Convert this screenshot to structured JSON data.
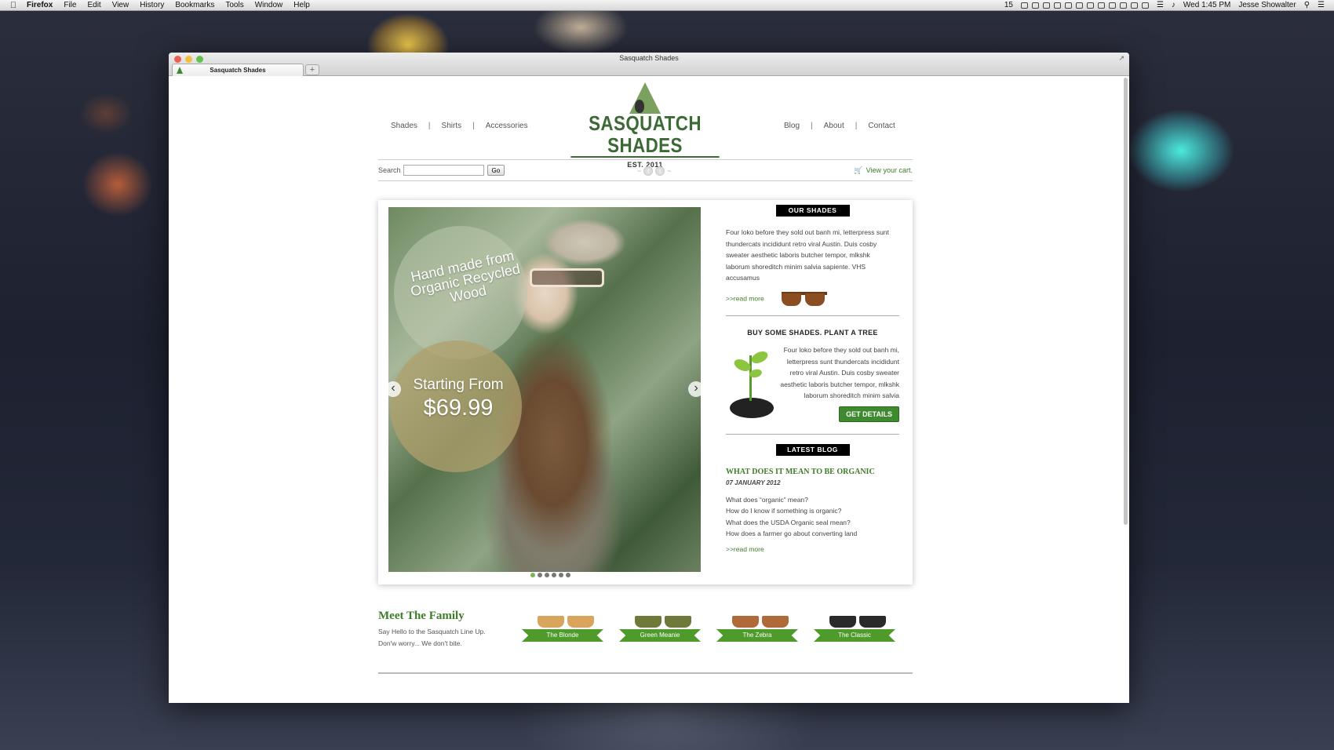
{
  "menubar": {
    "app_name": "Firefox",
    "items": [
      "File",
      "Edit",
      "View",
      "History",
      "Bookmarks",
      "Tools",
      "Window",
      "Help"
    ],
    "clock": "Wed 1:45 PM",
    "user": "Jesse Showalter",
    "badge": "15"
  },
  "window": {
    "title": "Sasquatch Shades",
    "tab_label": "Sasquatch Shades",
    "new_tab": "+"
  },
  "nav": {
    "left": [
      "Shades",
      "Shirts",
      "Accessories"
    ],
    "right": [
      "Blog",
      "About",
      "Contact"
    ],
    "separator": "|"
  },
  "logo": {
    "name": "SASQUATCH SHADES",
    "est": "EST. 2011"
  },
  "search": {
    "label": "Search",
    "value": "",
    "button": "Go"
  },
  "cart": {
    "label": "View your cart."
  },
  "hero": {
    "line1": "Hand made from Organic Recycled Wood",
    "starting": "Starting From",
    "price": "$69.99",
    "prev": "‹",
    "next": "›",
    "slide_count": 6,
    "active_slide": 1
  },
  "our_shades": {
    "label": "OUR SHADES",
    "text": "Four loko before they sold out banh mi, letterpress sunt thundercats incididunt retro viral Austin. Duis cosby sweater aesthetic laboris butcher tempor, mlkshk laborum shoreditch minim salvia sapiente. VHS accusamus",
    "read_more": ">>read more"
  },
  "plant_tree": {
    "title": "BUY SOME SHADES. PLANT A TREE",
    "text": "Four loko before they sold out banh mi, letterpress sunt thundercats incididunt retro viral Austin. Duis cosby sweater aesthetic laboris butcher tempor, mlkshk laborum shoreditch minim salvia",
    "button": "GET DETAILS"
  },
  "latest_blog": {
    "label": "LATEST BLOG",
    "title": "WHAT DOES IT MEAN TO BE ORGANIC",
    "date": "07 JANUARY 2012",
    "lines": [
      "What does “organic” mean?",
      "How do I know if something is organic?",
      "What does the USDA Organic seal mean?",
      "How does a farmer go about converting land"
    ],
    "read_more": ">>read more"
  },
  "family": {
    "title": "Meet The Family",
    "desc1": "Say Hello to the Sasquatch Line Up.",
    "desc2": "Don'w worry... We don't bite.",
    "products": [
      {
        "name": "The Blonde",
        "color": "#d9a55c"
      },
      {
        "name": "Green Meanie",
        "color": "#6f7a3a"
      },
      {
        "name": "The Zebra",
        "color": "#b06a3a"
      },
      {
        "name": "The Classic",
        "color": "#2a2a2a"
      }
    ]
  },
  "colors": {
    "brand_green": "#3d7c2a",
    "button_green": "#3e8a2e"
  }
}
